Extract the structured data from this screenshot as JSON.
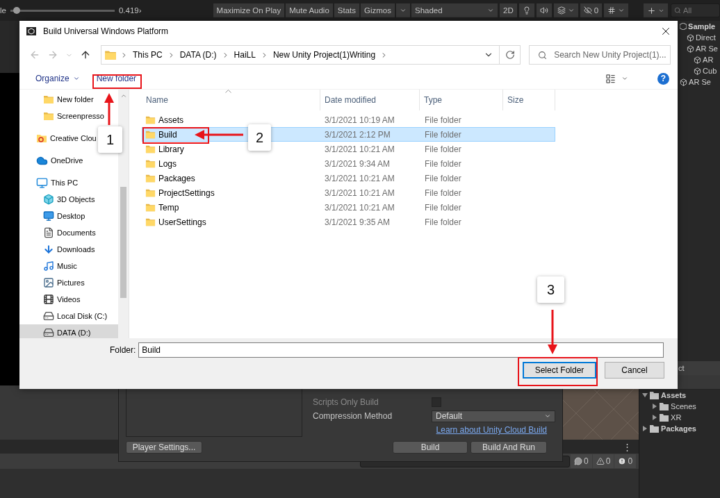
{
  "unity_toolbar": {
    "scale_label": "le",
    "scale_slider": {
      "level": 0.03
    },
    "scale_value": "0.419›",
    "play_options": [
      "Maximize On Play",
      "Mute Audio",
      "Stats",
      "Gizmos"
    ]
  },
  "scene_toolbar": {
    "shading": "Shaded",
    "mode_2d": "2D",
    "hidden_count": "0"
  },
  "hierarchy": {
    "search_placeholder": "All",
    "items": [
      {
        "label": "Sample",
        "kind": "scene",
        "children": [
          {
            "label": "Direct",
            "kind": "object"
          },
          {
            "label": "AR Se",
            "kind": "object",
            "children": [
              {
                "label": "AR",
                "kind": "object"
              },
              {
                "label": "Cub",
                "kind": "object"
              }
            ]
          }
        ]
      },
      {
        "label": "AR Se",
        "kind": "object"
      }
    ]
  },
  "dialog": {
    "title": "Build Universal Windows Platform",
    "breadcrumbs": [
      "This PC",
      "DATA (D:)",
      "HaiLL",
      "New Unity Project(1)Writing"
    ],
    "search_placeholder": "Search New Unity Project(1)...",
    "toolbar": {
      "organize": "Organize",
      "new_folder": "New folder",
      "help": "?"
    },
    "nav": {
      "continued_children": [
        {
          "label": "New folder",
          "kind": "folder",
          "selected": false
        },
        {
          "label": "Screenpresso",
          "kind": "folder",
          "selected": false
        }
      ],
      "items": [
        {
          "label": "Creative Clou",
          "kind": "cloud-folder",
          "selected": false
        },
        {
          "label": "OneDrive",
          "kind": "cloud",
          "selected": false
        },
        {
          "label": "This PC",
          "kind": "pc",
          "selected": false,
          "children": [
            {
              "label": "3D Objects",
              "kind": "cube",
              "selected": false
            },
            {
              "label": "Desktop",
              "kind": "desktop",
              "selected": false
            },
            {
              "label": "Documents",
              "kind": "document",
              "selected": false
            },
            {
              "label": "Downloads",
              "kind": "download",
              "selected": false
            },
            {
              "label": "Music",
              "kind": "music",
              "selected": false
            },
            {
              "label": "Pictures",
              "kind": "picture",
              "selected": false
            },
            {
              "label": "Videos",
              "kind": "video",
              "selected": false
            },
            {
              "label": "Local Disk (C:)",
              "kind": "drive",
              "selected": false
            },
            {
              "label": "DATA (D:)",
              "kind": "drive",
              "selected": true
            }
          ]
        }
      ]
    },
    "columns": [
      "Name",
      "Date modified",
      "Type",
      "Size"
    ],
    "rows": [
      {
        "name": "Assets",
        "date": "3/1/2021 10:19 AM",
        "type": "File folder",
        "selected": false
      },
      {
        "name": "Build",
        "date": "3/1/2021 2:12 PM",
        "type": "File folder",
        "selected": true
      },
      {
        "name": "Library",
        "date": "3/1/2021 10:21 AM",
        "type": "File folder",
        "selected": false
      },
      {
        "name": "Logs",
        "date": "3/1/2021 9:34 AM",
        "type": "File folder",
        "selected": false
      },
      {
        "name": "Packages",
        "date": "3/1/2021 10:21 AM",
        "type": "File folder",
        "selected": false
      },
      {
        "name": "ProjectSettings",
        "date": "3/1/2021 10:21 AM",
        "type": "File folder",
        "selected": false
      },
      {
        "name": "Temp",
        "date": "3/1/2021 10:21 AM",
        "type": "File folder",
        "selected": false
      },
      {
        "name": "UserSettings",
        "date": "3/1/2021 9:35 AM",
        "type": "File folder",
        "selected": false
      }
    ],
    "folder_label": "Folder:",
    "folder_value": "Build",
    "buttons": [
      {
        "label": "Select Folder",
        "primary": true
      },
      {
        "label": "Cancel",
        "primary": false
      }
    ]
  },
  "build_settings": {
    "options": [
      {
        "label": "Scripts Only Build",
        "kind": "checkbox",
        "checked": false
      },
      {
        "label": "Compression Method",
        "kind": "dropdown",
        "value": "Default"
      }
    ],
    "cloud_link": "Learn about Unity Cloud Build",
    "player_settings": "Player Settings...",
    "build": "Build",
    "build_and_run": "Build And Run"
  },
  "project": {
    "tab": "ct",
    "tree": [
      {
        "label": "Assets",
        "expanded": true,
        "children": [
          {
            "label": "Scenes",
            "expanded": false
          },
          {
            "label": "XR",
            "expanded": false
          }
        ]
      },
      {
        "label": "Packages",
        "expanded": false
      }
    ]
  },
  "console": {
    "menu": "⋮",
    "counts": [
      {
        "kind": "info",
        "value": "0"
      },
      {
        "kind": "warning",
        "value": "0"
      },
      {
        "kind": "error",
        "value": "0"
      }
    ]
  },
  "annotations": [
    {
      "number": "1"
    },
    {
      "number": "2"
    },
    {
      "number": "3"
    }
  ]
}
